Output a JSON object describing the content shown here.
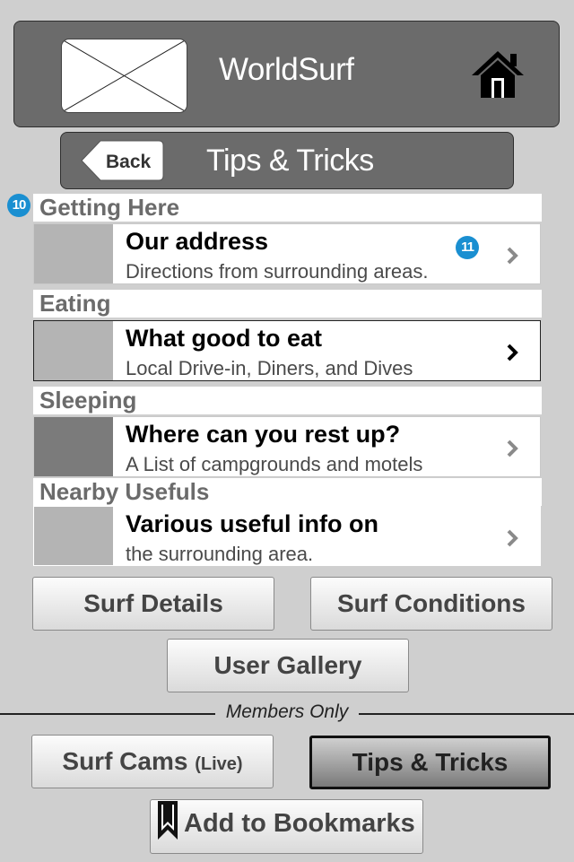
{
  "header": {
    "app_title": "WorldSurf",
    "logo_icon": "image-placeholder-icon",
    "home_icon": "home-icon"
  },
  "subheader": {
    "back_label": "Back",
    "title": "Tips & Tricks"
  },
  "badges": {
    "getting_here": "10",
    "address_row": "11"
  },
  "sections": [
    {
      "label": "Getting Here",
      "row": {
        "title": "Our address",
        "subtitle": "Directions from surrounding areas."
      }
    },
    {
      "label": "Eating",
      "row": {
        "title": "What good to eat",
        "subtitle": "Local Drive-in, Diners, and Dives"
      }
    },
    {
      "label": "Sleeping",
      "row": {
        "title": "Where can you rest up?",
        "subtitle": "A List of campgrounds and motels"
      }
    },
    {
      "label": "Nearby Usefuls",
      "row": {
        "title": "Various useful info on",
        "subtitle": "the surrounding area."
      }
    }
  ],
  "buttons": {
    "surf_details": "Surf Details",
    "surf_conditions": "Surf Conditions",
    "user_gallery": "User Gallery",
    "members_only": "Members Only",
    "surf_cams": "Surf Cams",
    "surf_cams_live": "(Live)",
    "tips_tricks": "Tips & Tricks",
    "add_bookmarks": "Add to Bookmarks"
  },
  "colors": {
    "badge": "#1a8fd1",
    "header_bg": "#6b6b6b",
    "page_bg": "#cfcfcf"
  }
}
